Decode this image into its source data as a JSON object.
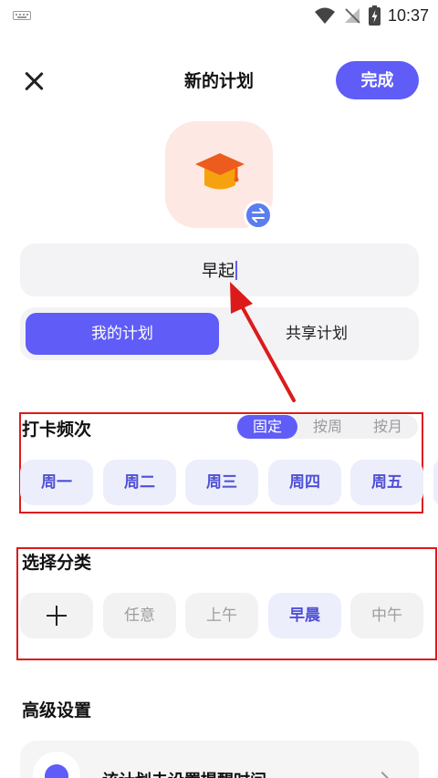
{
  "status_bar": {
    "time": "10:37"
  },
  "header": {
    "title": "新的计划",
    "done_label": "完成"
  },
  "plan": {
    "name": "早起"
  },
  "plan_type": {
    "options": [
      "我的计划",
      "共享计划"
    ],
    "selected": "我的计划"
  },
  "frequency": {
    "title": "打卡频次",
    "modes": [
      "固定",
      "按周",
      "按月"
    ],
    "selected_mode": "固定",
    "days": [
      "周一",
      "周二",
      "周三",
      "周四",
      "周五"
    ]
  },
  "category": {
    "title": "选择分类",
    "items": [
      "任意",
      "上午",
      "早晨",
      "中午"
    ],
    "selected": "早晨"
  },
  "advanced": {
    "title": "高级设置",
    "reminder_label": "该计划未设置提醒时间"
  },
  "colors": {
    "accent": "#5f5cf7",
    "icon_tile": "#fde8e4",
    "annotation": "#dd1a1a"
  }
}
